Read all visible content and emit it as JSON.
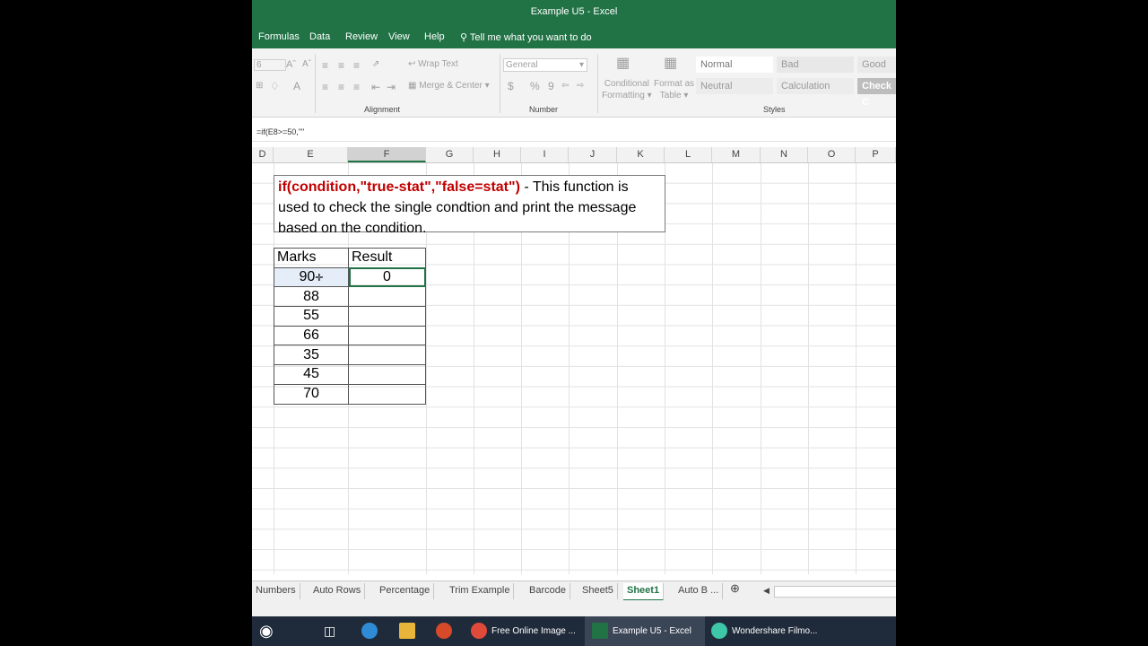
{
  "window": {
    "title": "Example U5  -  Excel"
  },
  "menu": {
    "items": [
      "Formulas",
      "Data",
      "Review",
      "View",
      "Help"
    ],
    "tell_me": "Tell me what you want to do"
  },
  "ribbon": {
    "font_size": "6",
    "wrap_text": "Wrap Text",
    "merge_center": "Merge & Center",
    "number_format": "General",
    "currency": "$",
    "percent": "%",
    "comma": "9",
    "conditional_formatting": [
      "Conditional",
      "Formatting"
    ],
    "format_as_table": [
      "Format as",
      "Table"
    ],
    "groups": {
      "alignment": "Alignment",
      "number": "Number",
      "styles": "Styles"
    },
    "styles": {
      "normal": "Normal",
      "bad": "Bad",
      "good": "Good",
      "neutral": "Neutral",
      "calculation": "Calculation",
      "check_cell": "Check C"
    }
  },
  "formula_bar": {
    "content": "=if(E8>=50,\"\""
  },
  "columns": [
    "D",
    "E",
    "F",
    "G",
    "H",
    "I",
    "J",
    "K",
    "L",
    "M",
    "N",
    "O",
    "P"
  ],
  "info": {
    "function": "if(condition,\"true-stat\",\"false=stat\")",
    "description": " - This function is used to check the single condtion and print the message based on the condition."
  },
  "table": {
    "headers": {
      "marks": "Marks",
      "result": "Result"
    },
    "marks": [
      "90",
      "88",
      "55",
      "66",
      "35",
      "45",
      "70"
    ],
    "first_result": "0"
  },
  "sheet_tabs": [
    "Numbers",
    "Auto Rows",
    "Percentage",
    "Trim Example",
    "Barcode",
    "Sheet5",
    "Sheet1",
    "Auto B ..."
  ],
  "active_tab": "Sheet1",
  "taskbar": {
    "items": [
      "Free Online Image ...",
      "Example U5 - Excel",
      "Wondershare Filmo..."
    ]
  }
}
